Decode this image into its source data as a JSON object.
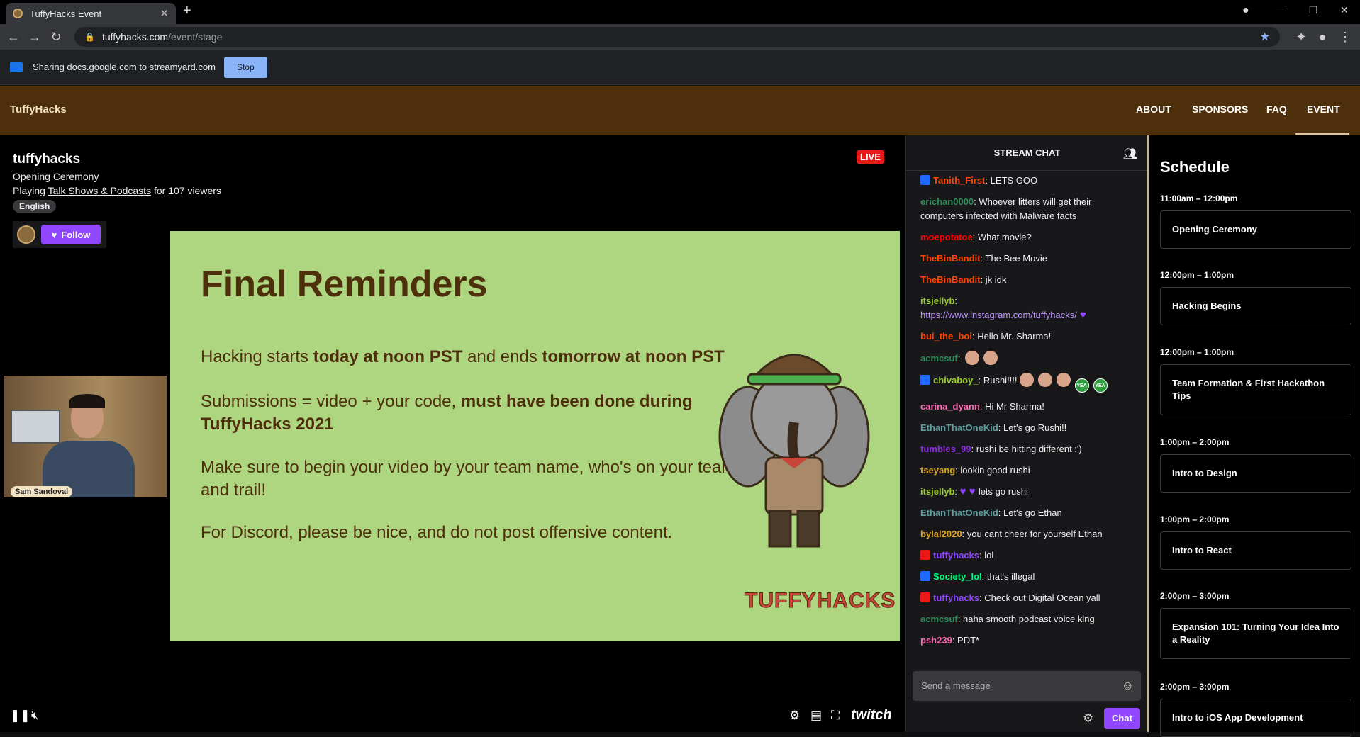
{
  "browser": {
    "tab_title": "TuffyHacks Event",
    "url_host": "tuffyhacks.com",
    "url_path": "/event/stage"
  },
  "share_bar": {
    "message": "Sharing docs.google.com to streamyard.com",
    "stop_label": "Stop"
  },
  "site": {
    "logo": "TuffyHacks",
    "nav": [
      "ABOUT",
      "SPONSORS",
      "FAQ",
      "EVENT"
    ],
    "active_nav": "EVENT"
  },
  "stream": {
    "channel": "tuffyhacks",
    "title": "Opening Ceremony",
    "playing_prefix": "Playing",
    "category": "Talk Shows & Podcasts",
    "viewers_text": "for 107 viewers",
    "language": "English",
    "live_badge": "LIVE",
    "follow_label": "Follow",
    "webcam_name": "Sam Sandoval",
    "brand": "twitch"
  },
  "slide": {
    "title": "Final Reminders",
    "line1_a": "Hacking starts ",
    "line1_b": "today at noon PST",
    "line1_c": " and ends ",
    "line1_d": "tomorrow at noon PST",
    "line2_a": "Submissions = video + your code, ",
    "line2_b": "must have been done during",
    "line2_c": "TuffyHacks 2021",
    "line3_a": "Make sure to begin your video by your team name, who's on your team",
    "line3_b": "and trail!",
    "line4": "For Discord, please be nice, and do not post offensive content.",
    "brand": "TUFFYHACKS"
  },
  "chat": {
    "header": "STREAM CHAT",
    "placeholder": "Send a message",
    "chat_button": "Chat",
    "messages": [
      {
        "user": "Tanith_First",
        "color": "#ff4500",
        "badge": "prime",
        "text": "LETS GOO"
      },
      {
        "user": "erichan0000",
        "color": "#2e8b57",
        "text": "Whoever litters will get their computers infected with Malware facts"
      },
      {
        "user": "moepotatoe",
        "color": "#ff0000",
        "text": "What movie?"
      },
      {
        "user": "TheBinBandit",
        "color": "#ff4500",
        "text": "The Bee Movie"
      },
      {
        "user": "TheBinBandit",
        "color": "#ff4500",
        "text": "jk idk"
      },
      {
        "user": "itsjellyb",
        "color": "#9acd32",
        "text": "",
        "link": "https://www.instagram.com/tuffyhacks/"
      },
      {
        "user": "bui_the_boi",
        "color": "#ff4500",
        "text": "Hello Mr. Sharma!"
      },
      {
        "user": "acmcsuf",
        "color": "#2e8b57",
        "text": "",
        "emotes": 2
      },
      {
        "user": "chivaboy_",
        "color": "#9acd32",
        "badge": "prime",
        "text": "Rushi!!!!",
        "emotes": 3,
        "yea": "YEA"
      },
      {
        "user": "carina_dyann",
        "color": "#ff69b4",
        "text": "Hi Mr Sharma!"
      },
      {
        "user": "EthanThatOneKid",
        "color": "#5f9ea0",
        "text": "Let's go Rushi!!"
      },
      {
        "user": "tumbles_99",
        "color": "#8a2be2",
        "text": "rushi be hitting different :')"
      },
      {
        "user": "tseyang",
        "color": "#daa520",
        "text": "lookin good rushi"
      },
      {
        "user": "itsjellyb",
        "color": "#9acd32",
        "text": "lets go rushi"
      },
      {
        "user": "EthanThatOneKid",
        "color": "#5f9ea0",
        "text": "Let's go Ethan"
      },
      {
        "user": "bylal2020",
        "color": "#daa520",
        "text": "you cant cheer for yourself Ethan"
      },
      {
        "user": "tuffyhacks",
        "color": "#9147ff",
        "badge": "broadcaster",
        "text": "lol"
      },
      {
        "user": "Society_lol",
        "color": "#00ff7f",
        "badge": "prime",
        "text": "that's illegal"
      },
      {
        "user": "tuffyhacks",
        "color": "#9147ff",
        "badge": "broadcaster",
        "text": "Check out Digital Ocean yall"
      },
      {
        "user": "acmcsuf",
        "color": "#2e8b57",
        "text": "haha smooth podcast voice king"
      },
      {
        "user": "psh239",
        "color": "#ff69b4",
        "text": "PDT*"
      }
    ]
  },
  "schedule": {
    "title": "Schedule",
    "items": [
      {
        "time": "11:00am – 12:00pm",
        "title": "Opening Ceremony"
      },
      {
        "time": "12:00pm – 1:00pm",
        "title": "Hacking Begins"
      },
      {
        "time": "12:00pm – 1:00pm",
        "title": "Team Formation & First Hackathon Tips"
      },
      {
        "time": "1:00pm – 2:00pm",
        "title": "Intro to Design"
      },
      {
        "time": "1:00pm – 2:00pm",
        "title": "Intro to React"
      },
      {
        "time": "2:00pm – 3:00pm",
        "title": "Expansion 101: Turning Your Idea Into a Reality"
      },
      {
        "time": "2:00pm – 3:00pm",
        "title": "Intro to iOS App Development"
      }
    ]
  }
}
